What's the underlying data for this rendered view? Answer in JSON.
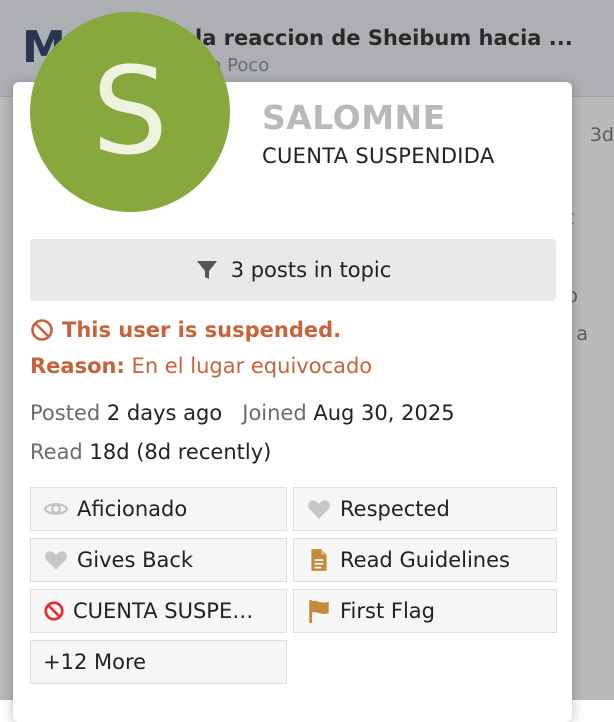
{
  "background": {
    "logo": "M",
    "topic_title": "la reaccion de Sheibum hacia ...",
    "topic_subtitle": "n Poco",
    "side_fragments": [
      "3d",
      "t",
      "o",
      "a"
    ]
  },
  "card": {
    "avatar_letter": "S",
    "username": "SALOMNE",
    "user_title": "CUENTA SUSPENDIDA",
    "posts_button": "3 posts in topic",
    "suspended_notice": "This user is suspended.",
    "reason_label": "Reason:",
    "reason_text": "En el lugar equivocado",
    "posted_label": "Posted",
    "posted_value": "2 days ago",
    "joined_label": "Joined",
    "joined_value": "Aug 30, 2025",
    "read_label": "Read",
    "read_value": "18d (8d recently)",
    "badges": [
      {
        "label": "Aficionado",
        "icon": "eye-icon"
      },
      {
        "label": "Respected",
        "icon": "heart-icon"
      },
      {
        "label": "Gives Back",
        "icon": "heart-icon"
      },
      {
        "label": "Read Guidelines",
        "icon": "file-icon"
      },
      {
        "label": "CUENTA SUSPE…",
        "icon": "ban-icon"
      },
      {
        "label": "First Flag",
        "icon": "flag-icon"
      },
      {
        "label": "+12 More",
        "icon": ""
      }
    ]
  },
  "colors": {
    "avatar": "#86a83c",
    "suspended": "#c6633a",
    "bronze": "#c48a3b",
    "badge_gray": "#c7c7c7"
  }
}
